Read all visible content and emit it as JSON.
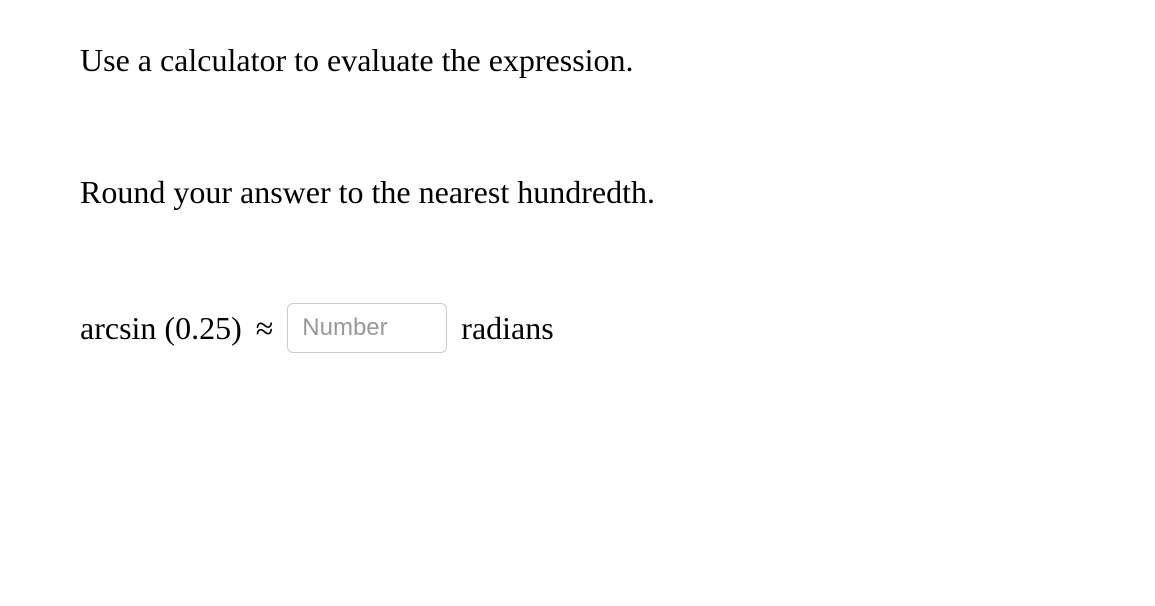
{
  "instruction": "Use a calculator to evaluate the expression.",
  "rounding": "Round your answer to the nearest hundredth.",
  "expression": "arcsin (0.25)",
  "approx_symbol": "≈",
  "input": {
    "placeholder": "Number",
    "value": ""
  },
  "unit": "radians"
}
